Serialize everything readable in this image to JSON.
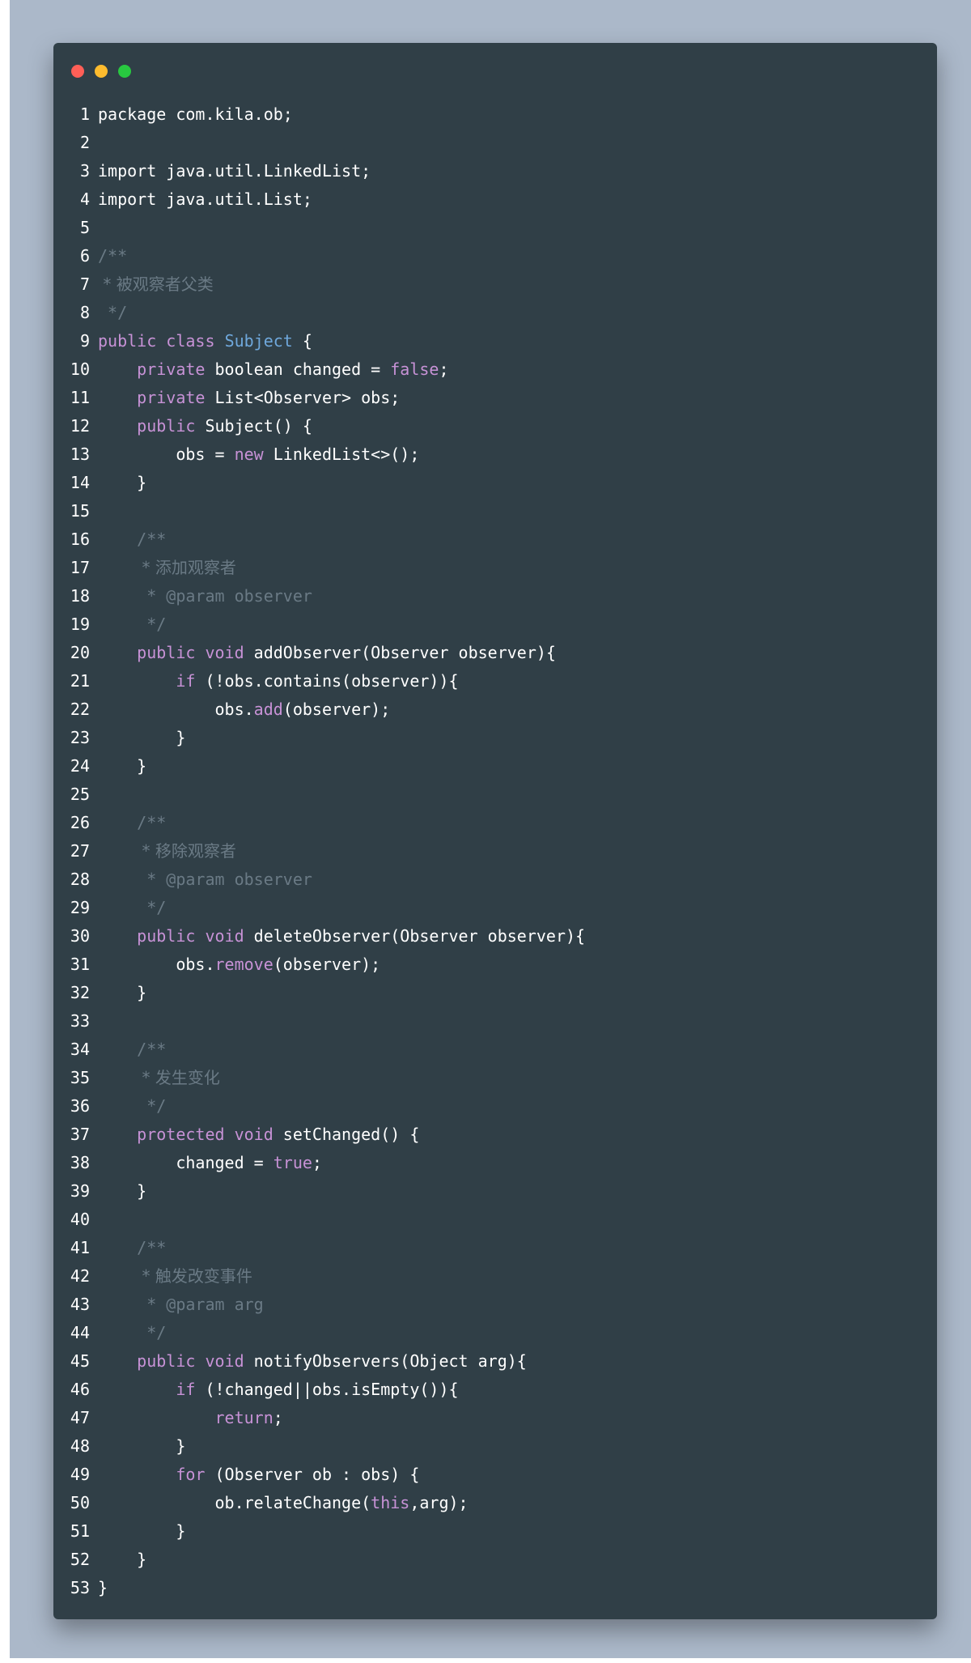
{
  "window": {
    "controls": [
      {
        "name": "close",
        "color": "#ff5f57"
      },
      {
        "name": "minimize",
        "color": "#febc2e"
      },
      {
        "name": "maximize",
        "color": "#28c840"
      }
    ]
  },
  "colors": {
    "background": "#abb8c9",
    "editor": "#303f47",
    "keyword": "#c792d6",
    "class_name": "#6fa8dc",
    "comment": "#6a7a85",
    "text": "#ffffff"
  },
  "code": {
    "language": "java",
    "lines": [
      [
        [
          "t",
          "package com.kila.ob;"
        ]
      ],
      [],
      [
        [
          "t",
          "import java.util.LinkedList;"
        ]
      ],
      [
        [
          "t",
          "import java.util.List;"
        ]
      ],
      [],
      [
        [
          "c",
          "/**"
        ]
      ],
      [
        [
          "c",
          " * 被观察者父类"
        ]
      ],
      [
        [
          "c",
          " */"
        ]
      ],
      [
        [
          "k",
          "public"
        ],
        [
          "t",
          " "
        ],
        [
          "k",
          "class"
        ],
        [
          "t",
          " "
        ],
        [
          "n",
          "Subject"
        ],
        [
          "t",
          " {"
        ]
      ],
      [
        [
          "t",
          "    "
        ],
        [
          "k",
          "private"
        ],
        [
          "t",
          " boolean changed = "
        ],
        [
          "k",
          "false"
        ],
        [
          "t",
          ";"
        ]
      ],
      [
        [
          "t",
          "    "
        ],
        [
          "k",
          "private"
        ],
        [
          "t",
          " List<Observer> obs;"
        ]
      ],
      [
        [
          "t",
          "    "
        ],
        [
          "k",
          "public"
        ],
        [
          "t",
          " Subject() {"
        ]
      ],
      [
        [
          "t",
          "        obs = "
        ],
        [
          "k",
          "new"
        ],
        [
          "t",
          " LinkedList<>();"
        ]
      ],
      [
        [
          "t",
          "    }"
        ]
      ],
      [],
      [
        [
          "t",
          "    "
        ],
        [
          "c",
          "/**"
        ]
      ],
      [
        [
          "t",
          "    "
        ],
        [
          "c",
          " * 添加观察者"
        ]
      ],
      [
        [
          "t",
          "    "
        ],
        [
          "c",
          " * @param observer"
        ]
      ],
      [
        [
          "t",
          "    "
        ],
        [
          "c",
          " */"
        ]
      ],
      [
        [
          "t",
          "    "
        ],
        [
          "k",
          "public"
        ],
        [
          "t",
          " "
        ],
        [
          "k",
          "void"
        ],
        [
          "t",
          " addObserver(Observer observer){"
        ]
      ],
      [
        [
          "t",
          "        "
        ],
        [
          "k",
          "if"
        ],
        [
          "t",
          " (!obs.contains(observer)){"
        ]
      ],
      [
        [
          "t",
          "            obs."
        ],
        [
          "k",
          "add"
        ],
        [
          "t",
          "(observer);"
        ]
      ],
      [
        [
          "t",
          "        }"
        ]
      ],
      [
        [
          "t",
          "    }"
        ]
      ],
      [],
      [
        [
          "t",
          "    "
        ],
        [
          "c",
          "/**"
        ]
      ],
      [
        [
          "t",
          "    "
        ],
        [
          "c",
          " * 移除观察者"
        ]
      ],
      [
        [
          "t",
          "    "
        ],
        [
          "c",
          " * @param observer"
        ]
      ],
      [
        [
          "t",
          "    "
        ],
        [
          "c",
          " */"
        ]
      ],
      [
        [
          "t",
          "    "
        ],
        [
          "k",
          "public"
        ],
        [
          "t",
          " "
        ],
        [
          "k",
          "void"
        ],
        [
          "t",
          " deleteObserver(Observer observer){"
        ]
      ],
      [
        [
          "t",
          "        obs."
        ],
        [
          "k",
          "remove"
        ],
        [
          "t",
          "(observer);"
        ]
      ],
      [
        [
          "t",
          "    }"
        ]
      ],
      [],
      [
        [
          "t",
          "    "
        ],
        [
          "c",
          "/**"
        ]
      ],
      [
        [
          "t",
          "    "
        ],
        [
          "c",
          " * 发生变化"
        ]
      ],
      [
        [
          "t",
          "    "
        ],
        [
          "c",
          " */"
        ]
      ],
      [
        [
          "t",
          "    "
        ],
        [
          "k",
          "protected"
        ],
        [
          "t",
          " "
        ],
        [
          "k",
          "void"
        ],
        [
          "t",
          " setChanged() {"
        ]
      ],
      [
        [
          "t",
          "        changed = "
        ],
        [
          "k",
          "true"
        ],
        [
          "t",
          ";"
        ]
      ],
      [
        [
          "t",
          "    }"
        ]
      ],
      [],
      [
        [
          "t",
          "    "
        ],
        [
          "c",
          "/**"
        ]
      ],
      [
        [
          "t",
          "    "
        ],
        [
          "c",
          " * 触发改变事件"
        ]
      ],
      [
        [
          "t",
          "    "
        ],
        [
          "c",
          " * @param arg"
        ]
      ],
      [
        [
          "t",
          "    "
        ],
        [
          "c",
          " */"
        ]
      ],
      [
        [
          "t",
          "    "
        ],
        [
          "k",
          "public"
        ],
        [
          "t",
          " "
        ],
        [
          "k",
          "void"
        ],
        [
          "t",
          " notifyObservers(Object arg){"
        ]
      ],
      [
        [
          "t",
          "        "
        ],
        [
          "k",
          "if"
        ],
        [
          "t",
          " (!changed||obs.isEmpty()){"
        ]
      ],
      [
        [
          "t",
          "            "
        ],
        [
          "k",
          "return"
        ],
        [
          "t",
          ";"
        ]
      ],
      [
        [
          "t",
          "        }"
        ]
      ],
      [
        [
          "t",
          "        "
        ],
        [
          "k",
          "for"
        ],
        [
          "t",
          " (Observer ob : obs) {"
        ]
      ],
      [
        [
          "t",
          "            ob.relateChange("
        ],
        [
          "k",
          "this"
        ],
        [
          "t",
          ",arg);"
        ]
      ],
      [
        [
          "t",
          "        }"
        ]
      ],
      [
        [
          "t",
          "    }"
        ]
      ],
      [
        [
          "t",
          "}"
        ]
      ]
    ]
  }
}
